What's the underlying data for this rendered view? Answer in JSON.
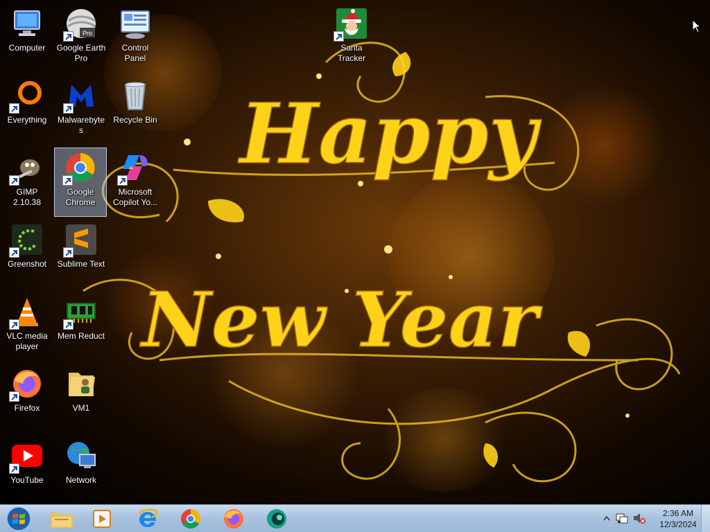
{
  "desktop": {
    "wallpaper": {
      "line1": "Happy",
      "line2": "New Year"
    },
    "icons": [
      {
        "label": "Computer",
        "icon": "computer-icon"
      },
      {
        "label": "Google Earth Pro",
        "icon": "google-earth-icon"
      },
      {
        "label": "Control Panel",
        "icon": "control-panel-icon"
      },
      {
        "label": "Santa Tracker",
        "icon": "santa-tracker-icon"
      },
      {
        "label": "Everything",
        "icon": "everything-icon"
      },
      {
        "label": "Malwarebytes",
        "icon": "malwarebytes-icon"
      },
      {
        "label": "Recycle Bin",
        "icon": "recycle-bin-icon"
      },
      {
        "label": "GIMP 2.10.38",
        "icon": "gimp-icon"
      },
      {
        "label": "Google Chrome",
        "icon": "chrome-icon"
      },
      {
        "label": "Microsoft Copilot  Yo...",
        "icon": "copilot-icon"
      },
      {
        "label": "Greenshot",
        "icon": "greenshot-icon"
      },
      {
        "label": "Sublime Text",
        "icon": "sublime-text-icon"
      },
      {
        "label": "VLC media player",
        "icon": "vlc-icon"
      },
      {
        "label": "Mem Reduct",
        "icon": "mem-reduct-icon"
      },
      {
        "label": "Firefox",
        "icon": "firefox-icon"
      },
      {
        "label": "VM1",
        "icon": "folder-icon"
      },
      {
        "label": "YouTube",
        "icon": "youtube-icon"
      },
      {
        "label": "Network",
        "icon": "network-icon"
      }
    ]
  },
  "taskbar": {
    "start": {
      "icon": "windows-start-icon"
    },
    "pinned": [
      {
        "icon": "file-explorer-icon"
      },
      {
        "icon": "media-player-icon"
      },
      {
        "icon": "internet-explorer-icon"
      },
      {
        "icon": "chrome-icon"
      },
      {
        "icon": "firefox-icon"
      },
      {
        "icon": "app-icon"
      }
    ],
    "tray": {
      "time": "2:36 AM",
      "date": "12/3/2024",
      "icons": [
        "show-hidden-icons-chevron",
        "network-tray-icon",
        "volume-muted-icon"
      ]
    }
  },
  "colors": {
    "accent_gold": "#ffd21a",
    "taskbar": "#a9c3df",
    "selection": "#aac8f0"
  }
}
